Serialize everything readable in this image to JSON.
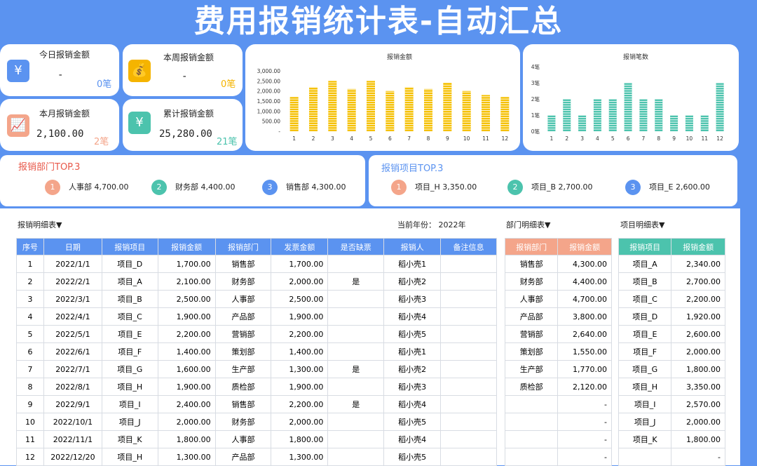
{
  "title": "费用报销统计表-自动汇总",
  "kpis": {
    "today": {
      "label": "今日报销金额",
      "value": "-",
      "count": "0笔",
      "icon": "yen-icon",
      "color": "#5b93f0"
    },
    "week": {
      "label": "本周报销金额",
      "value": "-",
      "count": "0笔",
      "icon": "money-bag-icon",
      "color": "#f5b400"
    },
    "month": {
      "label": "本月报销金额",
      "value": "2,100.00",
      "count": "2笔",
      "icon": "chart-icon",
      "color": "#f4a58a"
    },
    "total": {
      "label": "累计报销金额",
      "value": "25,280.00",
      "count": "21笔",
      "icon": "wallet-icon",
      "color": "#4cc3ad"
    }
  },
  "chart_data": [
    {
      "type": "bar",
      "title": "报销金额",
      "categories": [
        "1",
        "2",
        "3",
        "4",
        "5",
        "6",
        "7",
        "8",
        "9",
        "10",
        "11",
        "12"
      ],
      "values": [
        1700,
        2200,
        2500,
        2100,
        2500,
        2000,
        2200,
        2100,
        2400,
        2000,
        1800,
        1700
      ],
      "yticks": [
        "3,000.00",
        "2,500.00",
        "2,000.00",
        "1,500.00",
        "1,000.00",
        "500.00",
        "-"
      ],
      "ylim": [
        0,
        3000
      ],
      "color": "#f5c000"
    },
    {
      "type": "bar",
      "title": "报销笔数",
      "categories": [
        "1",
        "2",
        "3",
        "4",
        "5",
        "6",
        "7",
        "8",
        "9",
        "10",
        "11",
        "12"
      ],
      "values": [
        1,
        2,
        1,
        2,
        2,
        3,
        2,
        2,
        1,
        1,
        1,
        3
      ],
      "yticks": [
        "4笔",
        "3笔",
        "2笔",
        "1笔",
        "0笔"
      ],
      "ylim": [
        0,
        4
      ],
      "color": "#4cc3ad"
    }
  ],
  "dept_top3": {
    "title": "报销部门TOP.3",
    "items": [
      {
        "rank": "1",
        "text": "人事部 4,700.00",
        "color": "#f4a58a"
      },
      {
        "rank": "2",
        "text": "财务部 4,400.00",
        "color": "#4cc3ad"
      },
      {
        "rank": "3",
        "text": "销售部 4,300.00",
        "color": "#5b93f0"
      }
    ]
  },
  "proj_top3": {
    "title": "报销项目TOP.3",
    "items": [
      {
        "rank": "1",
        "text": "项目_H 3,350.00",
        "color": "#f4a58a"
      },
      {
        "rank": "2",
        "text": "项目_B 2,700.00",
        "color": "#4cc3ad"
      },
      {
        "rank": "3",
        "text": "项目_E 2,600.00",
        "color": "#5b93f0"
      }
    ]
  },
  "detail": {
    "label": "报销明细表▼",
    "year_label": "当前年份： 2022年",
    "headers": [
      "序号",
      "日期",
      "报销项目",
      "报销金额",
      "报销部门",
      "发票金额",
      "是否缺票",
      "报销人",
      "备注信息"
    ],
    "rows": [
      [
        "1",
        "2022/1/1",
        "项目_D",
        "1,700.00",
        "销售部",
        "1,700.00",
        "",
        "稻小壳1",
        ""
      ],
      [
        "2",
        "2022/2/1",
        "项目_A",
        "2,100.00",
        "财务部",
        "2,000.00",
        "是",
        "稻小壳2",
        ""
      ],
      [
        "3",
        "2022/3/1",
        "项目_B",
        "2,500.00",
        "人事部",
        "2,500.00",
        "",
        "稻小壳3",
        ""
      ],
      [
        "4",
        "2022/4/1",
        "项目_C",
        "1,900.00",
        "产品部",
        "1,900.00",
        "",
        "稻小壳4",
        ""
      ],
      [
        "5",
        "2022/5/1",
        "项目_E",
        "2,200.00",
        "营销部",
        "2,200.00",
        "",
        "稻小壳5",
        ""
      ],
      [
        "6",
        "2022/6/1",
        "项目_F",
        "1,400.00",
        "策划部",
        "1,400.00",
        "",
        "稻小壳1",
        ""
      ],
      [
        "7",
        "2022/7/1",
        "项目_G",
        "1,600.00",
        "生产部",
        "1,300.00",
        "是",
        "稻小壳2",
        ""
      ],
      [
        "8",
        "2022/8/1",
        "项目_H",
        "1,900.00",
        "质检部",
        "1,900.00",
        "",
        "稻小壳3",
        ""
      ],
      [
        "9",
        "2022/9/1",
        "项目_I",
        "2,400.00",
        "销售部",
        "2,200.00",
        "是",
        "稻小壳4",
        ""
      ],
      [
        "10",
        "2022/10/1",
        "项目_J",
        "2,000.00",
        "财务部",
        "2,000.00",
        "",
        "稻小壳5",
        ""
      ],
      [
        "11",
        "2022/11/1",
        "项目_K",
        "1,800.00",
        "人事部",
        "1,800.00",
        "",
        "稻小壳4",
        ""
      ],
      [
        "12",
        "2022/12/20",
        "项目_H",
        "1,300.00",
        "产品部",
        "1,300.00",
        "",
        "稻小壳5",
        ""
      ]
    ]
  },
  "dept_detail": {
    "label": "部门明细表▼",
    "headers": [
      "报销部门",
      "报销金额"
    ],
    "rows": [
      [
        "销售部",
        "4,300.00"
      ],
      [
        "财务部",
        "4,400.00"
      ],
      [
        "人事部",
        "4,700.00"
      ],
      [
        "产品部",
        "3,800.00"
      ],
      [
        "营销部",
        "2,640.00"
      ],
      [
        "策划部",
        "1,550.00"
      ],
      [
        "生产部",
        "1,770.00"
      ],
      [
        "质检部",
        "2,120.00"
      ],
      [
        "",
        "-"
      ],
      [
        "",
        "-"
      ],
      [
        "",
        "-"
      ],
      [
        "",
        "-"
      ]
    ]
  },
  "proj_detail": {
    "label": "项目明细表▼",
    "headers": [
      "报销项目",
      "报销金额"
    ],
    "rows": [
      [
        "项目_A",
        "2,340.00"
      ],
      [
        "项目_B",
        "2,700.00"
      ],
      [
        "项目_C",
        "2,200.00"
      ],
      [
        "项目_D",
        "1,920.00"
      ],
      [
        "项目_E",
        "2,600.00"
      ],
      [
        "项目_F",
        "2,000.00"
      ],
      [
        "项目_G",
        "1,800.00"
      ],
      [
        "项目_H",
        "3,350.00"
      ],
      [
        "项目_I",
        "2,570.00"
      ],
      [
        "项目_J",
        "2,000.00"
      ],
      [
        "项目_K",
        "1,800.00"
      ],
      [
        "",
        "-"
      ]
    ]
  },
  "colors": {
    "blue": "#5b93f0",
    "salmon": "#f4a58a",
    "teal": "#4cc3ad",
    "red_title": "#e8584a"
  }
}
